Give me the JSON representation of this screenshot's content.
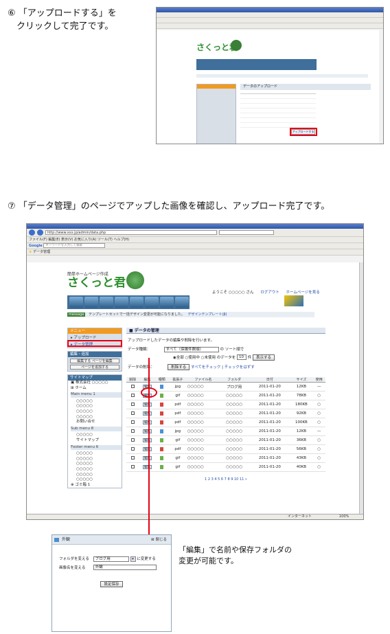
{
  "step6": {
    "num": "⑥",
    "line1": "「アップロードする」を",
    "line2": "クリックして完了です。"
  },
  "step7": {
    "num": "⑦",
    "text": "「データ管理」のページでアップした画像を確認し、アップロード完了です。"
  },
  "browser": {
    "menu": [
      "ファイル(F)",
      "編集(E)",
      "表示(V)",
      "お気に入り(A)",
      "ツール(T)",
      "ヘルプ(H)"
    ],
    "address": "http://www.xxx.jp/admin/data.php",
    "search_placeholder": "キーワードを入力して検索",
    "tab_title": "データ管理",
    "status_text": "インターネット",
    "zoom": "100%"
  },
  "site": {
    "logo_small": "簡単ホームページ作成",
    "logo": "さくっと君",
    "welcome": "ようこそ ○○○○○ さん",
    "logout": "ログアウト",
    "home_link": "ホームページを見る",
    "message_badge": "message",
    "message_text": "テンプレートセットで一括デザイン変更が可能になりました。",
    "message_link": "デザインテンプレート(β)"
  },
  "sidebar": {
    "menu_title": "メニュー",
    "upload": "アップロード",
    "data_mgmt": "データ管理",
    "edit_title": "編集・追加",
    "edit_btn1": "編集する ページを編集",
    "edit_btn2": "ページを追加する",
    "sitemap_title": "サイトマップ",
    "company": "株式会社 ○○○○○",
    "home": "ホーム",
    "main_menu": "Main menu 1",
    "main_items": [
      "○○○○○",
      "○○○○○",
      "○○○○○",
      "○○○○○",
      "お問い合せ"
    ],
    "sub_menu": "Sub menu 8",
    "sub_items": [
      "○○○○○",
      "サイトマップ"
    ],
    "footer_menu": "Footer menu 6",
    "footer_items": [
      "○○○○○",
      "○○○○○",
      "○○○○○",
      "○○○○○",
      "○○○○○",
      "○○○○○"
    ],
    "trash": "ゴミ箱 1"
  },
  "data_page": {
    "title": "データの管理",
    "desc": "アップロードしたデータの編集や削除を行います。",
    "kind_label": "データ種類：",
    "kind_value": "すべて（保護件数順）",
    "kind_suffix": "の ソート順で",
    "radio_all": "全部",
    "radio_used": "使用中",
    "radio_unused": "未使用",
    "radio_suffix": "のデータを",
    "count": "10",
    "count_suffix": "件",
    "show_btn": "表示する",
    "bulk_label": "データの削除：",
    "bulk_btn": "削除する",
    "check_all": "すべてをチェック",
    "uncheck_all": "チェックをはずす",
    "columns": [
      "削除",
      "編集",
      "種類",
      "拡張子",
      "ファイル名",
      "フォルダ",
      "日付",
      "サイズ",
      "使用"
    ],
    "rows": [
      {
        "ext": "jpg",
        "name": "○○○○○",
        "folder": "ブログ用",
        "date": "2011-01-20",
        "size": "12KB",
        "used": "—"
      },
      {
        "ext": "gif",
        "name": "○○○○○",
        "folder": "○○○○○",
        "date": "2011-01-20",
        "size": "78KB",
        "used": "○"
      },
      {
        "ext": "pdf",
        "name": "○○○○○",
        "folder": "○○○○○",
        "date": "2011-01-20",
        "size": "180KB",
        "used": "○"
      },
      {
        "ext": "pdf",
        "name": "○○○○○",
        "folder": "○○○○○",
        "date": "2011-01-20",
        "size": "92KB",
        "used": "○"
      },
      {
        "ext": "pdf",
        "name": "○○○○○",
        "folder": "○○○○○",
        "date": "2011-01-20",
        "size": "100KB",
        "used": "○"
      },
      {
        "ext": "jpg",
        "name": "○○○○○",
        "folder": "○○○○○",
        "date": "2011-01-20",
        "size": "12KB",
        "used": "—"
      },
      {
        "ext": "gif",
        "name": "○○○○○",
        "folder": "○○○○○",
        "date": "2011-01-20",
        "size": "36KB",
        "used": "○"
      },
      {
        "ext": "pdf",
        "name": "○○○○○",
        "folder": "○○○○○",
        "date": "2011-01-20",
        "size": "56KB",
        "used": "○"
      },
      {
        "ext": "gif",
        "name": "○○○○○",
        "folder": "○○○○○",
        "date": "2011-01-20",
        "size": "43KB",
        "used": "○"
      },
      {
        "ext": "gif",
        "name": "○○○○○",
        "folder": "○○○○○",
        "date": "2011-01-20",
        "size": "40KB",
        "used": "○"
      }
    ],
    "edit_label": "編集",
    "pager": "1 2 3 4 5 6 7 8 9 10 11 »"
  },
  "small_shot": {
    "site_logo": "さくっと君",
    "panel_title": "データのアップロード",
    "upload_btn": "アップロードする"
  },
  "dialog": {
    "title": "外観",
    "close": "閉じる",
    "folder_label": "フォルダを変える",
    "folder_value": "ブログ用",
    "folder_suffix": "に変更する",
    "name_label": "画像名を変える",
    "name_value": "外観",
    "save_btn": "設定保存"
  },
  "caption": {
    "line1": "「編集」で名前や保存フォルダの",
    "line2": "変更が可能です。"
  }
}
